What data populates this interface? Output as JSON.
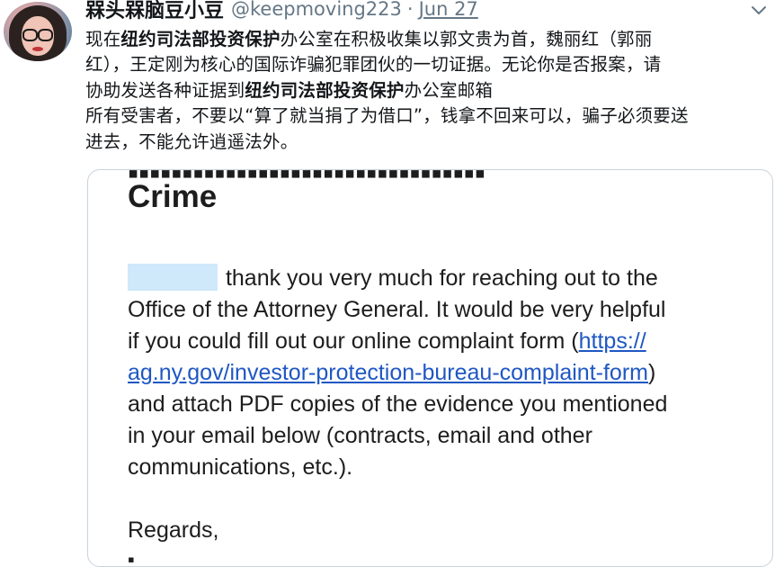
{
  "tweet": {
    "display_name": "槑头槑脑豆小豆",
    "handle": "@keepmoving223",
    "separator": "·",
    "date": "Jun 27",
    "text_lines": [
      [
        {
          "t": "现在",
          "b": false
        },
        {
          "t": "纽约司法部投资保护",
          "b": true
        },
        {
          "t": "办公室在积极收集以郭文贵为首，魏丽红（郭丽",
          "b": false
        }
      ],
      [
        {
          "t": "红），王定刚为核心的国际诈骗犯罪团伙的一切证据。无论你是否报案，请",
          "b": false
        }
      ],
      [
        {
          "t": "协助发送各种证据到",
          "b": false
        },
        {
          "t": "纽约司法部投资保护",
          "b": true
        },
        {
          "t": "办公室邮箱",
          "b": false
        }
      ],
      [
        {
          "t": "所有受害者，不要以“算了就当捐了为借口”，钱拿不回来可以，骗子必须要送",
          "b": false
        }
      ],
      [
        {
          "t": "进去，不能允许逍遥法外。",
          "b": false
        }
      ]
    ]
  },
  "card": {
    "title": "Crime",
    "greeting_rest": "thank you very much for reaching out to the",
    "line2": "Office of the Attorney General.  It would be very helpful",
    "line3_pre": "if you could fill out our online complaint form (",
    "line3_link": "https://",
    "line4_link": "ag.ny.gov/investor-protection-bureau-complaint-form",
    "line4_post": ")",
    "line5": "and attach PDF copies of the evidence you mentioned",
    "line6": "in your email below (contracts, email and other",
    "line7": "communications, etc.).",
    "regards": "Regards,"
  },
  "icons": {
    "caret": "chevron-down-icon",
    "avatar": "profile-photo"
  },
  "colors": {
    "text": "#14171a",
    "secondary": "#657786",
    "link": "#1f57c3",
    "redaction": "#cfe8fa",
    "card_border": "#c9d3dc"
  }
}
